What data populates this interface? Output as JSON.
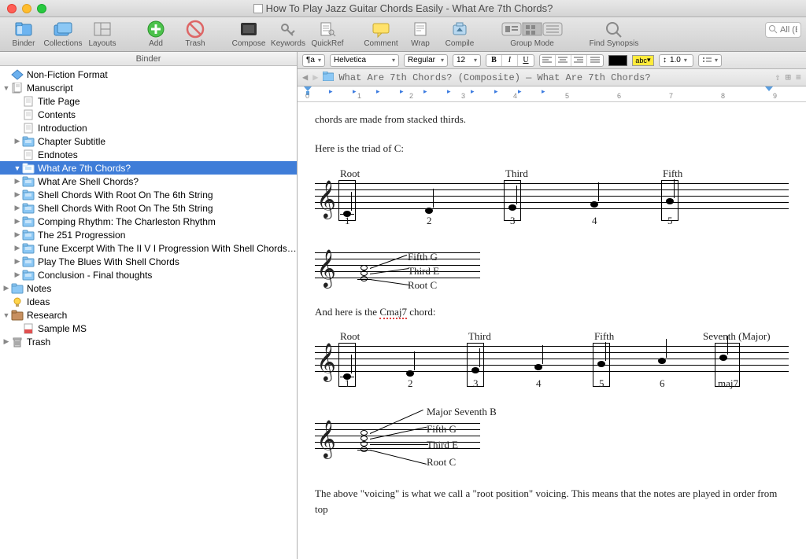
{
  "window": {
    "title": "How To Play Jazz Guitar Chords Easily - What Are 7th Chords?"
  },
  "toolbar": {
    "binder": "Binder",
    "collections": "Collections",
    "layouts": "Layouts",
    "add": "Add",
    "trash": "Trash",
    "compose": "Compose",
    "keywords": "Keywords",
    "quickref": "QuickRef",
    "comment": "Comment",
    "wrap": "Wrap",
    "compile": "Compile",
    "groupmode": "Group Mode",
    "findsynopsis": "Find Synopsis"
  },
  "search_placeholder": "All (Exact)",
  "sidebar": {
    "header": "Binder",
    "items": [
      {
        "label": "Non-Fiction Format",
        "icon": "template",
        "depth": 0,
        "disc": ""
      },
      {
        "label": "Manuscript",
        "icon": "manuscript",
        "depth": 0,
        "disc": "▼"
      },
      {
        "label": "Title Page",
        "icon": "text",
        "depth": 1,
        "disc": ""
      },
      {
        "label": "Contents",
        "icon": "text",
        "depth": 1,
        "disc": ""
      },
      {
        "label": "Introduction",
        "icon": "text",
        "depth": 1,
        "disc": ""
      },
      {
        "label": "Chapter Subtitle",
        "icon": "folder",
        "depth": 1,
        "disc": "▶"
      },
      {
        "label": "Endnotes",
        "icon": "text",
        "depth": 1,
        "disc": ""
      },
      {
        "label": "What Are 7th Chords?",
        "icon": "folder-sel",
        "depth": 1,
        "disc": "▼",
        "sel": true
      },
      {
        "label": "What Are Shell Chords?",
        "icon": "folder",
        "depth": 1,
        "disc": "▶"
      },
      {
        "label": "Shell Chords With Root On The 6th String",
        "icon": "folder",
        "depth": 1,
        "disc": "▶"
      },
      {
        "label": "Shell Chords With Root On The 5th String",
        "icon": "folder",
        "depth": 1,
        "disc": "▶"
      },
      {
        "label": "Comping Rhythm: The Charleston Rhythm",
        "icon": "folder",
        "depth": 1,
        "disc": "▶"
      },
      {
        "label": "The 251 Progression",
        "icon": "folder",
        "depth": 1,
        "disc": "▶"
      },
      {
        "label": "Tune Excerpt With The  II V I Progression With Shell Chords: Autu...",
        "icon": "folder",
        "depth": 1,
        "disc": "▶"
      },
      {
        "label": "Play The Blues With Shell Chords",
        "icon": "folder",
        "depth": 1,
        "disc": "▶"
      },
      {
        "label": "Conclusion - Final thoughts",
        "icon": "folder",
        "depth": 1,
        "disc": "▶"
      },
      {
        "label": "Notes",
        "icon": "folder-plain",
        "depth": 0,
        "disc": "▶"
      },
      {
        "label": "Ideas",
        "icon": "idea",
        "depth": 0,
        "disc": ""
      },
      {
        "label": "Research",
        "icon": "research",
        "depth": 0,
        "disc": "▼"
      },
      {
        "label": "Sample MS",
        "icon": "pdf",
        "depth": 1,
        "disc": ""
      },
      {
        "label": "Trash",
        "icon": "trash",
        "depth": 0,
        "disc": "▶"
      }
    ]
  },
  "formatbar": {
    "para": "¶a",
    "font": "Helvetica",
    "weight": "Regular",
    "size": "12",
    "bold": "B",
    "italic": "I",
    "under": "U",
    "linespace": "1.0",
    "hl": "abc"
  },
  "headerbar": {
    "path": "What Are 7th Chords? (Composite) — What Are 7th Chords?"
  },
  "ruler": {
    "nums": [
      "0",
      "1",
      "2",
      "3",
      "4",
      "5",
      "6",
      "7",
      "8",
      "9"
    ]
  },
  "doc": {
    "line0": "chords are made from stacked thirds.",
    "triad_intro": "Here is the triad of C:",
    "labels_triad": {
      "root": "Root",
      "third": "Third",
      "fifth": "Fifth"
    },
    "nums_triad": {
      "n1": "1",
      "n2": "2",
      "n3": "3",
      "n4": "4",
      "n5": "5"
    },
    "anno_triad": {
      "fifth": "Fifth G",
      "third": "Third E",
      "root": "Root C"
    },
    "maj7_intro_pre": "And here is the ",
    "maj7_chord": "Cmaj7",
    "maj7_intro_post": " chord:",
    "labels_maj7": {
      "root": "Root",
      "third": "Third",
      "fifth": "Fifth",
      "seventh": "Seventh (Major)"
    },
    "nums_maj7": {
      "n1": "1",
      "n2": "2",
      "n3": "3",
      "n4": "4",
      "n5": "5",
      "n6": "6",
      "n7": "maj7"
    },
    "anno_maj7": {
      "seventh": "Major Seventh B",
      "fifth": "Fifth G",
      "third": "Third E",
      "root": "Root C"
    },
    "outro": "The above \"voicing\" is what we call a \"root position\" voicing. This means that the notes are played in order from top"
  }
}
